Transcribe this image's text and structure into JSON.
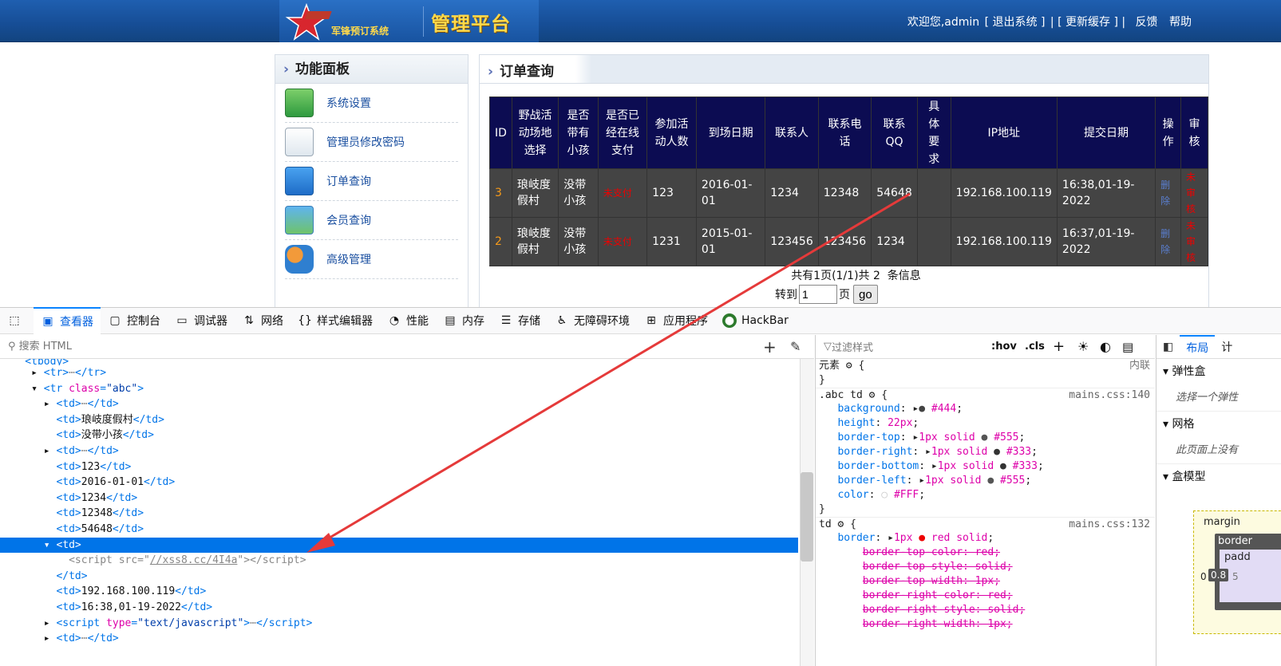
{
  "header": {
    "logo_sub": "军锋预订系统",
    "logo_main": "管理平台",
    "welcome": "欢迎您,admin",
    "logout": "[ 退出系统 ]",
    "refresh": "| [ 更新缓存 ] |",
    "feedback": "反馈",
    "help": "帮助"
  },
  "panel": {
    "title": "功能面板",
    "items": [
      {
        "label": "系统设置",
        "icon": "settings-icon"
      },
      {
        "label": "管理员修改密码",
        "icon": "edit-password-icon"
      },
      {
        "label": "订单查询",
        "icon": "order-query-icon"
      },
      {
        "label": "会员查询",
        "icon": "member-query-icon"
      },
      {
        "label": "高级管理",
        "icon": "users-icon"
      }
    ]
  },
  "orders": {
    "title": "订单查询",
    "columns": [
      "ID",
      "野战活动场地选择",
      "是否带有小孩",
      "是否已经在线支付",
      "参加活动人数",
      "到场日期",
      "联系人",
      "联系电话",
      "联系QQ",
      "具体要求",
      "IP地址",
      "提交日期",
      "操作",
      "审核"
    ],
    "rows": [
      {
        "id": "3",
        "site": "琅岐度假村",
        "child": "没带小孩",
        "paid": "未支付",
        "people": "123",
        "date": "2016-01-01",
        "contact": "1234",
        "phone": "12348",
        "qq": "54648",
        "req": "",
        "ip": "192.168.100.119",
        "submit": "16:38,01-19-2022",
        "op": "删除",
        "audit": "未审核"
      },
      {
        "id": "2",
        "site": "琅岐度假村",
        "child": "没带小孩",
        "paid": "未支付",
        "people": "1231",
        "date": "2015-01-01",
        "contact": "123456",
        "phone": "123456",
        "qq": "1234",
        "req": "",
        "ip": "192.168.100.119",
        "submit": "16:37,01-19-2022",
        "op": "删除",
        "audit": "未审核"
      }
    ],
    "pager_text": "共有1页(1/1)共 2  条信息",
    "goto_label": "转到",
    "page_value": "1",
    "page_unit": "页",
    "go_label": "go"
  },
  "devtools": {
    "tabs": [
      {
        "label": "查看器",
        "icon": "inspector-icon",
        "active": true
      },
      {
        "label": "控制台",
        "icon": "console-icon"
      },
      {
        "label": "调试器",
        "icon": "debugger-icon"
      },
      {
        "label": "网络",
        "icon": "network-icon"
      },
      {
        "label": "样式编辑器",
        "icon": "style-editor-icon"
      },
      {
        "label": "性能",
        "icon": "performance-icon"
      },
      {
        "label": "内存",
        "icon": "memory-icon"
      },
      {
        "label": "存储",
        "icon": "storage-icon"
      },
      {
        "label": "无障碍环境",
        "icon": "accessibility-icon"
      },
      {
        "label": "应用程序",
        "icon": "application-icon"
      },
      {
        "label": "HackBar",
        "icon": "hackbar-icon"
      }
    ],
    "html_search_placeholder": "搜索 HTML",
    "css_filter_placeholder": "过滤样式",
    "hov": ":hov",
    "cls": ".cls",
    "layout_tabs": [
      "布局",
      "计"
    ],
    "layout_sections": [
      {
        "title": "弹性盒",
        "sub": "选择一个弹性"
      },
      {
        "title": "网格",
        "sub": "此页面上没有"
      },
      {
        "title": "盒模型",
        "sub": ""
      }
    ],
    "boxmodel": {
      "margin": "margin",
      "border": "border",
      "padding": "padd",
      "value": "0.8",
      "left_zero": "0",
      "right_five": "5"
    }
  }
}
